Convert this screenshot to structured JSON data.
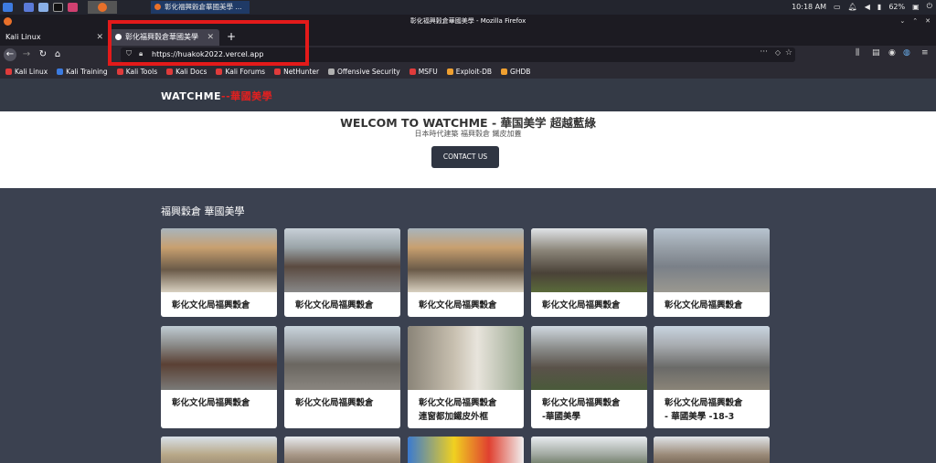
{
  "taskbar": {
    "window_title": "彰化福興穀倉華國美學 ...",
    "time": "10:18 AM",
    "battery": "62%"
  },
  "window": {
    "title": "彰化福興穀倉華國美學 - Mozilla Firefox"
  },
  "tabs": [
    {
      "label": "Kali Linux"
    },
    {
      "label": "彰化福興穀倉華國美學"
    }
  ],
  "nav": {
    "url": "https://huakok2022.vercel.app"
  },
  "bookmarks": [
    {
      "label": "Kali Linux",
      "color": "#e03b3b"
    },
    {
      "label": "Kali Training",
      "color": "#3b7be0"
    },
    {
      "label": "Kali Tools",
      "color": "#e03b3b"
    },
    {
      "label": "Kali Docs",
      "color": "#e03b3b"
    },
    {
      "label": "Kali Forums",
      "color": "#e03b3b"
    },
    {
      "label": "NetHunter",
      "color": "#e03b3b"
    },
    {
      "label": "Offensive Security",
      "color": "#b0b0b0"
    },
    {
      "label": "MSFU",
      "color": "#e03b3b"
    },
    {
      "label": "Exploit-DB",
      "color": "#f0a030"
    },
    {
      "label": "GHDB",
      "color": "#f0a030"
    }
  ],
  "site": {
    "logo_white": "WATCHME",
    "logo_red": "--華國美學",
    "hero_title": "WELCOM TO WATCHME - 華国美学 超越藍綠",
    "hero_subtitle": "日本時代建築 福興穀倉 鐵皮加蓋",
    "contact_button": "CONTACT US",
    "section_title": "福興穀倉 華國美學",
    "cards": [
      {
        "line1": "彰化文化局福興穀倉",
        "line2": ""
      },
      {
        "line1": "彰化文化局福興穀倉",
        "line2": ""
      },
      {
        "line1": "彰化文化局福興穀倉",
        "line2": ""
      },
      {
        "line1": "彰化文化局福興穀倉",
        "line2": ""
      },
      {
        "line1": "彰化文化局福興穀倉",
        "line2": ""
      },
      {
        "line1": "彰化文化局福興穀倉",
        "line2": ""
      },
      {
        "line1": "彰化文化局福興穀倉",
        "line2": ""
      },
      {
        "line1": "彰化文化局福興穀倉",
        "line2": "連窗都加鐵皮外框"
      },
      {
        "line1": "彰化文化局福興穀倉",
        "line2": "-華國美學"
      },
      {
        "line1": "彰化文化局福興穀倉",
        "line2": "- 華國美學 -18-3"
      }
    ]
  },
  "colors": {
    "accent_red": "#e02020",
    "highlight_box": "#e31a1a"
  }
}
